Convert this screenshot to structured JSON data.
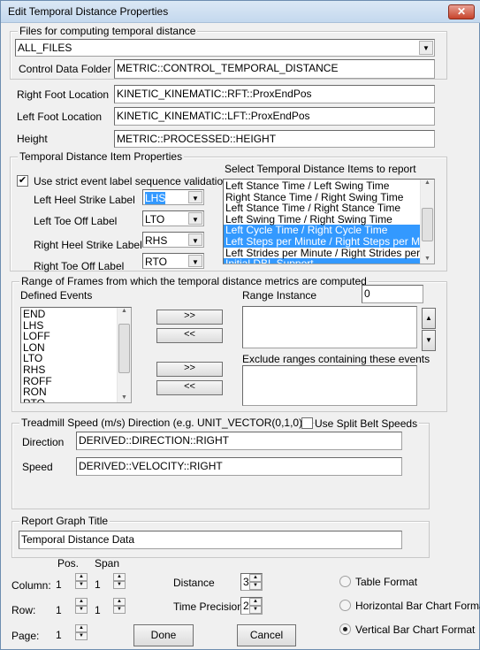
{
  "window": {
    "title": "Edit Temporal Distance Properties",
    "close": "✕"
  },
  "files": {
    "legend": "Files for computing temporal distance",
    "selected": "ALL_FILES",
    "control_label": "Control Data Folder",
    "control_value": "METRIC::CONTROL_TEMPORAL_DISTANCE"
  },
  "locations": {
    "right_label": "Right Foot Location",
    "right_value": "KINETIC_KINEMATIC::RFT::ProxEndPos",
    "left_label": "Left Foot Location",
    "left_value": "KINETIC_KINEMATIC::LFT::ProxEndPos",
    "height_label": "Height",
    "height_value": "METRIC::PROCESSED::HEIGHT"
  },
  "items": {
    "legend": "Temporal Distance Item Properties",
    "strict_label": "Use strict event label sequence validation",
    "strict_checked": true,
    "labels": [
      {
        "label": "Left Heel Strike Label",
        "value": "LHS"
      },
      {
        "label": "Left Toe Off Label",
        "value": "LTO"
      },
      {
        "label": "Right Heel Strike Label",
        "value": "RHS"
      },
      {
        "label": "Right Toe Off Label",
        "value": "RTO"
      }
    ],
    "select_label": "Select Temporal Distance Items to report",
    "list": [
      {
        "text": "Left Stance Time / Left Swing Time",
        "selected": false
      },
      {
        "text": "Right Stance Time / Right Swing Time",
        "selected": false
      },
      {
        "text": "Left Stance Time / Right Stance Time",
        "selected": false
      },
      {
        "text": "Left Swing Time / Right Swing Time",
        "selected": false
      },
      {
        "text": "Left Cycle Time / Right Cycle Time",
        "selected": true
      },
      {
        "text": "Left Steps per Minute / Right Steps per Minute",
        "selected": true
      },
      {
        "text": "Left Strides per Minute / Right Strides per Minute",
        "selected": false
      },
      {
        "text": "Initial DBL Support",
        "selected": true
      }
    ]
  },
  "range": {
    "legend": "Range of Frames from which the temporal distance metrics are computed",
    "defined_label": "Defined Events",
    "events": [
      "END",
      "LHS",
      "LOFF",
      "LON",
      "LTO",
      "RHS",
      "ROFF",
      "RON",
      "RTO"
    ],
    "add": ">>",
    "remove": "<<",
    "instance_label": "Range Instance",
    "instance_value": "0",
    "exclude_label": "Exclude ranges containing these events"
  },
  "treadmill": {
    "legend": "Treadmill Speed (m/s) Direction (e.g. UNIT_VECTOR(0,1,0)",
    "split_label": "Use Split Belt Speeds",
    "split_checked": false,
    "direction_label": "Direction",
    "direction_value": "DERIVED::DIRECTION::RIGHT",
    "speed_label": "Speed",
    "speed_value": "DERIVED::VELOCITY::RIGHT"
  },
  "graph": {
    "legend": "Report Graph Title",
    "value": "Temporal Distance Data"
  },
  "layout": {
    "pos": "Pos.",
    "span": "Span",
    "column_label": "Column:",
    "column_pos": "1",
    "column_span": "1",
    "row_label": "Row:",
    "row_pos": "1",
    "row_span": "1",
    "page_label": "Page:",
    "page_value": "1"
  },
  "precision": {
    "distance_label": "Distance",
    "distance_value": "3",
    "time_label": "Time Precision",
    "time_value": "2"
  },
  "format": {
    "options": [
      {
        "label": "Table Format",
        "selected": false
      },
      {
        "label": "Horizontal Bar Chart Format",
        "selected": false
      },
      {
        "label": "Vertical Bar Chart Format",
        "selected": true
      }
    ]
  },
  "buttons": {
    "done": "Done",
    "cancel": "Cancel"
  }
}
